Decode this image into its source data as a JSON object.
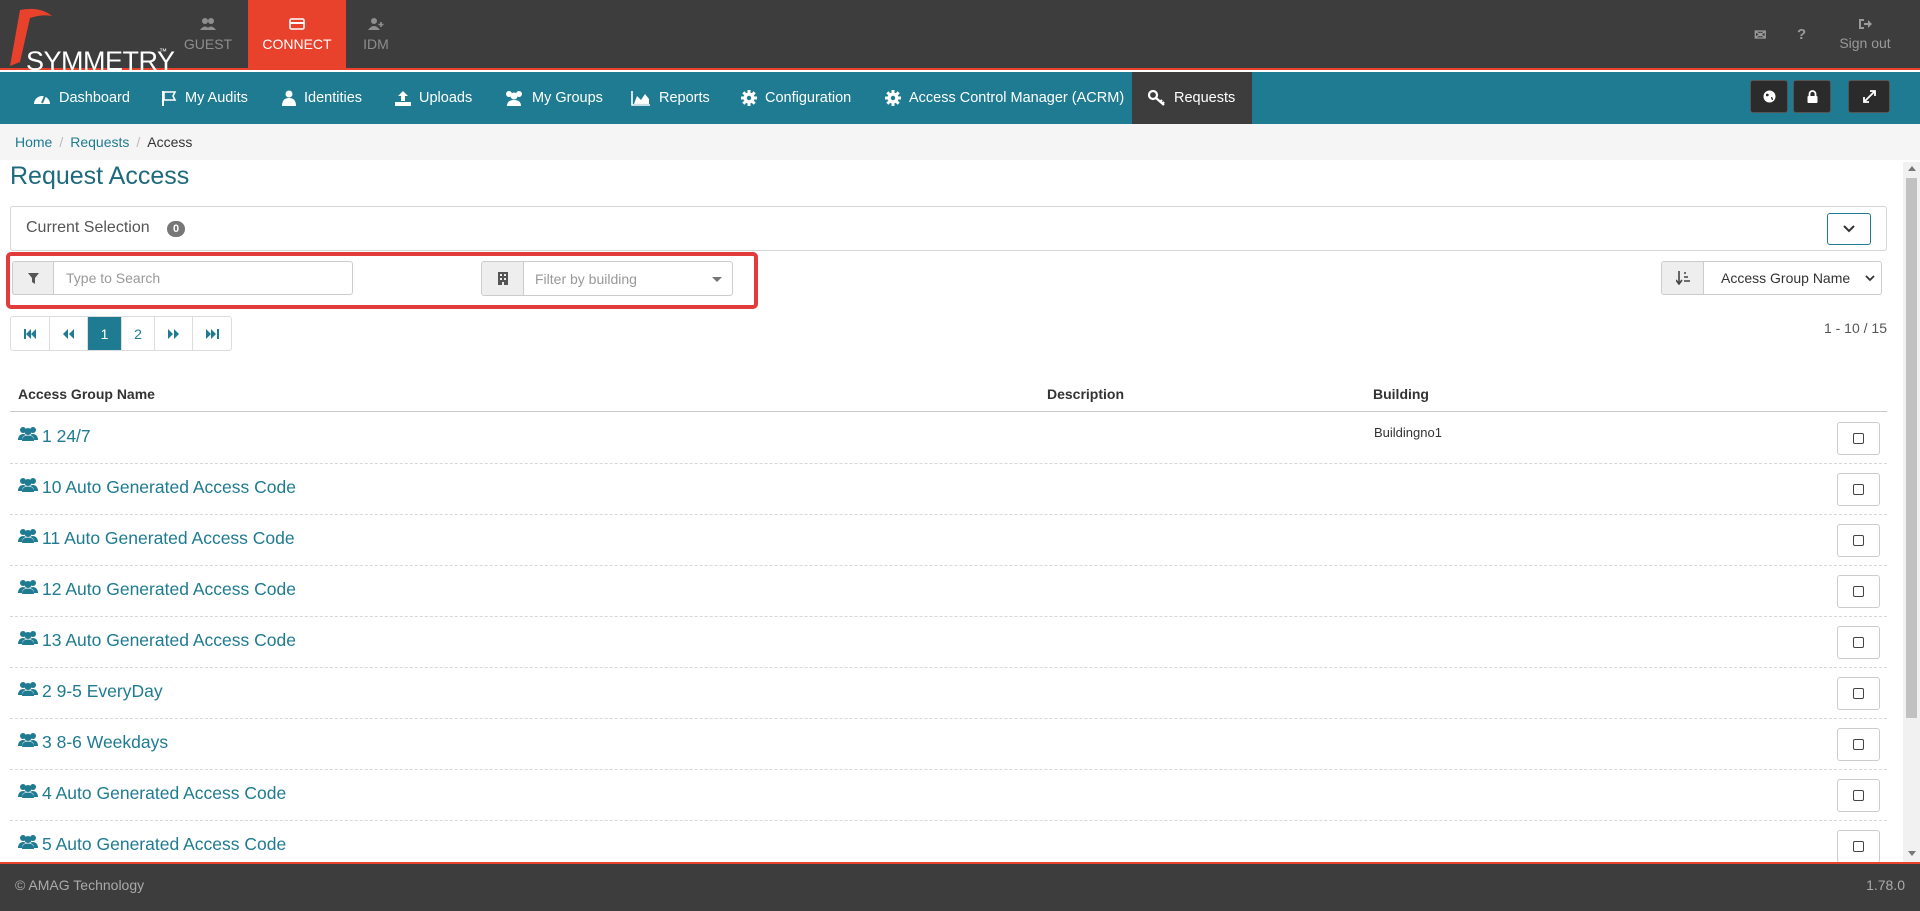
{
  "app": {
    "logo_text": "SYMMETRY",
    "logo_tm": "™",
    "modules": [
      {
        "label": "GUEST",
        "icon": "users-icon",
        "active": false
      },
      {
        "label": "CONNECT",
        "icon": "card-icon",
        "active": true
      },
      {
        "label": "IDM",
        "icon": "user-plus-icon",
        "active": false
      }
    ],
    "top_icons": {
      "mail": "✉",
      "help": "?"
    },
    "signout_label": "Sign out",
    "brand_color": "#e8412c",
    "accent_color": "#1e7b91"
  },
  "nav": {
    "items": [
      {
        "label": "Dashboard",
        "icon": "dashboard-icon"
      },
      {
        "label": "My Audits",
        "icon": "flag-icon"
      },
      {
        "label": "Identities",
        "icon": "user-icon"
      },
      {
        "label": "Uploads",
        "icon": "upload-icon"
      },
      {
        "label": "My Groups",
        "icon": "users-icon"
      },
      {
        "label": "Reports",
        "icon": "area-chart-icon"
      },
      {
        "label": "Configuration",
        "icon": "gear-icon"
      },
      {
        "label": "Access Control Manager (ACRM)",
        "icon": "gear-icon"
      },
      {
        "label": "Requests",
        "icon": "key-icon",
        "active": true
      }
    ],
    "right_buttons": [
      "globe-icon",
      "lock-icon",
      "expand-icon"
    ]
  },
  "breadcrumb": {
    "home": "Home",
    "requests": "Requests",
    "current": "Access",
    "sep": "/"
  },
  "page": {
    "title": "Request Access",
    "current_selection_label": "Current Selection",
    "current_selection_count": "0"
  },
  "filters": {
    "search_placeholder": "Type to Search",
    "building_placeholder": "Filter by building",
    "sort_selected": "Access Group Name"
  },
  "pagination": {
    "pages": [
      "1",
      "2"
    ],
    "active_page": "1",
    "range_text": "1 - 10 / 15"
  },
  "table": {
    "columns": {
      "name": "Access Group Name",
      "description": "Description",
      "building": "Building"
    },
    "rows": [
      {
        "name": "1 24/7",
        "description": "",
        "building": "Buildingno1"
      },
      {
        "name": "10 Auto Generated Access Code",
        "description": "",
        "building": ""
      },
      {
        "name": "11 Auto Generated Access Code",
        "description": "",
        "building": ""
      },
      {
        "name": "12 Auto Generated Access Code",
        "description": "",
        "building": ""
      },
      {
        "name": "13 Auto Generated Access Code",
        "description": "",
        "building": ""
      },
      {
        "name": "2 9-5 EveryDay",
        "description": "",
        "building": ""
      },
      {
        "name": "3 8-6 Weekdays",
        "description": "",
        "building": ""
      },
      {
        "name": "4 Auto Generated Access Code",
        "description": "",
        "building": ""
      },
      {
        "name": "5 Auto Generated Access Code",
        "description": "",
        "building": ""
      }
    ]
  },
  "footer": {
    "copyright": "© AMAG Technology",
    "version": "1.78.0"
  }
}
